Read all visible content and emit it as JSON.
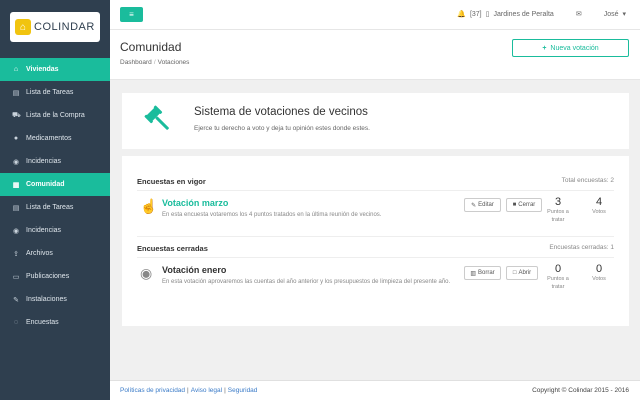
{
  "brand": {
    "name": "COLINDAR"
  },
  "sidebar": {
    "items": [
      {
        "label": "Viviendas",
        "icon": "home-icon",
        "glyph": "⌂",
        "active": true
      },
      {
        "label": "Lista de Tareas",
        "icon": "list-icon",
        "glyph": "▤",
        "active": false
      },
      {
        "label": "Lista de la Compra",
        "icon": "cart-icon",
        "glyph": "⛟",
        "active": false
      },
      {
        "label": "Medicamentos",
        "icon": "pill-icon",
        "glyph": "●",
        "active": false
      },
      {
        "label": "Incidencias",
        "icon": "alert-icon",
        "glyph": "◉",
        "active": false
      },
      {
        "label": "Comunidad",
        "icon": "building-icon",
        "glyph": "▦",
        "active": true
      },
      {
        "label": "Lista de Tareas",
        "icon": "list-icon",
        "glyph": "▤",
        "active": false
      },
      {
        "label": "Incidencias",
        "icon": "alert-icon",
        "glyph": "◉",
        "active": false
      },
      {
        "label": "Archivos",
        "icon": "upload-icon",
        "glyph": "⇪",
        "active": false
      },
      {
        "label": "Publicaciones",
        "icon": "newspaper-icon",
        "glyph": "▭",
        "active": false
      },
      {
        "label": "Instalaciones",
        "icon": "wrench-icon",
        "glyph": "✎",
        "active": false
      },
      {
        "label": "Encuestas",
        "icon": "chat-icon",
        "glyph": "◌",
        "active": false
      }
    ]
  },
  "topbar": {
    "notifications": "[37]",
    "community": "Jardines de Peralta",
    "user": "José"
  },
  "header": {
    "title": "Comunidad",
    "breadcrumb_home": "Dashboard",
    "breadcrumb_sep": "/",
    "breadcrumb_current": "Votaciones",
    "new_button": "Nueva votación"
  },
  "hero": {
    "title": "Sistema de votaciones de vecinos",
    "subtitle": "Ejerce tu derecho a voto y deja tu opinión estes donde estes."
  },
  "open_section": {
    "title": "Encuestas en vigor",
    "count": "Total encuestas: 2",
    "item": {
      "title": "Votación marzo",
      "description": "En esta encuesta votaremos los 4 puntos tratados en la última reunión de vecinos.",
      "btn1": "Editar",
      "btn2": "Cerrar",
      "stat1_num": "3",
      "stat1_label": "Puntos a tratar",
      "stat2_num": "4",
      "stat2_label": "Votos"
    }
  },
  "closed_section": {
    "title": "Encuestas cerradas",
    "count": "Encuestas cerradas: 1",
    "item": {
      "title": "Votación enero",
      "description": "En esta votación aprovaremos las cuentas del año anterior y los presupuestos de limpieza del presente año.",
      "btn1": "Borrar",
      "btn2": "Abrir",
      "stat1_num": "0",
      "stat1_label": "Puntos a tratar",
      "stat2_num": "0",
      "stat2_label": "Votos"
    }
  },
  "footer": {
    "link1": "Políticas de privacidad",
    "link2": "Aviso legal",
    "link3": "Seguridad",
    "sep": "|",
    "copyright": "Copyright © Colindar 2015 - 2016"
  },
  "colors": {
    "accent": "#1abc9c",
    "sidebar": "#2f3f4f"
  }
}
